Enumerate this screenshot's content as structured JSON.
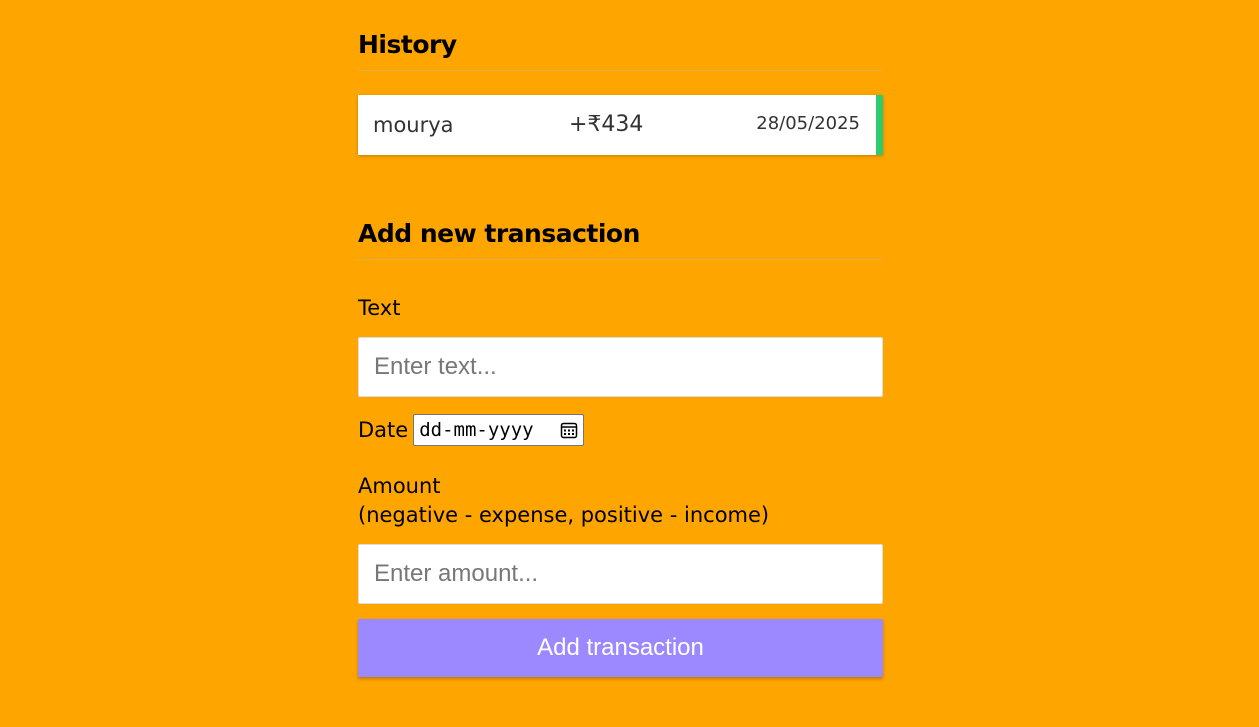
{
  "history": {
    "title": "History",
    "items": [
      {
        "text": "mourya",
        "amount": "+₹434",
        "date": "28/05/2025",
        "status_color": "#2ECC71"
      }
    ]
  },
  "add_transaction": {
    "title": "Add new transaction",
    "text_label": "Text",
    "text_placeholder": "Enter text...",
    "date_label": "Date",
    "date_placeholder": "dd-mm-yyyy",
    "amount_label": "Amount",
    "amount_hint": "(negative - expense, positive - income)",
    "amount_placeholder": "Enter amount...",
    "submit_label": "Add transaction"
  },
  "colors": {
    "background": "#FFA500",
    "accent_button": "#9C88FF",
    "income": "#2ECC71"
  },
  "icons": {
    "date_picker": "calendar-icon"
  }
}
